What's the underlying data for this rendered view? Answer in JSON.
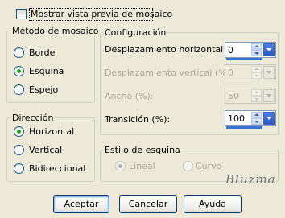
{
  "preview_checkbox": {
    "label": "Mostrar vista previa de mosaico",
    "checked": false
  },
  "method_group": {
    "title": "Método de mosaico",
    "options": [
      "Borde",
      "Esquina",
      "Espejo"
    ],
    "selected": "Esquina"
  },
  "direction_group": {
    "title": "Dirección",
    "options": [
      "Horizontal",
      "Vertical",
      "Bidireccional"
    ],
    "selected": "Horizontal"
  },
  "config_group": {
    "title": "Configuración",
    "fields": [
      {
        "label": "Desplazamiento horizontal (%):",
        "value": "0",
        "enabled": true
      },
      {
        "label": "Desplazamiento vertical (%):",
        "value": "0",
        "enabled": false
      },
      {
        "label": "Ancho (%):",
        "value": "50",
        "enabled": false
      },
      {
        "label": "Transición (%):",
        "value": "100",
        "enabled": true
      }
    ]
  },
  "corner_style_group": {
    "title": "Estilo de esquina",
    "options": [
      "Lineal",
      "Curvo"
    ],
    "selected": "Lineal",
    "enabled": false
  },
  "buttons": {
    "ok": "Aceptar",
    "cancel": "Cancelar",
    "help": "Ayuda"
  },
  "watermark": "Bluzma",
  "colors": {
    "dialog_bg": "#ece9d8",
    "radio_dot": "#21a121",
    "spin_accent": "#3a73d8"
  }
}
